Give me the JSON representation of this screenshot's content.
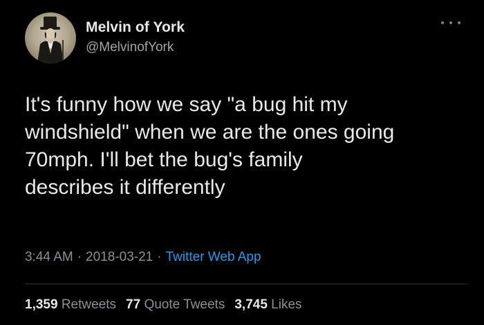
{
  "author": {
    "display_name": "Melvin of York",
    "handle": "@MelvinofYork",
    "avatar_icon": "portrait-avatar"
  },
  "tweet": {
    "text": "It's funny how we say \"a bug hit my\nwindshield\" when we are the ones going\n70mph. I'll bet the bug's family\ndescribes it differently",
    "time": "3:44 AM",
    "date": "2018-03-21",
    "separator": "·",
    "source": "Twitter Web App"
  },
  "stats": {
    "retweets_count": "1,359",
    "retweets_label": "Retweets",
    "quote_count": "77",
    "quote_label": "Quote Tweets",
    "likes_count": "3,745",
    "likes_label": "Likes"
  },
  "icons": {
    "more": "more-options-icon"
  },
  "colors": {
    "background": "#000000",
    "text": "#e7e9ea",
    "secondary": "#8b9096",
    "link": "#1d9bf0"
  }
}
